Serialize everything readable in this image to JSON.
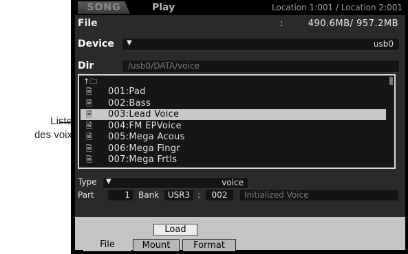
{
  "callout": {
    "line1": "Liste",
    "line2": "des voix"
  },
  "header": {
    "mode_tab": "SONG",
    "sub_tab": "Play",
    "location": "Location 1:001 / Location 2:001"
  },
  "file": {
    "label": "File",
    "colon": ":",
    "size": "490.6MB/  957.2MB"
  },
  "device": {
    "label": "Device",
    "value": "usb0",
    "arrow": "▼"
  },
  "dir": {
    "label": "Dir",
    "value": "/usb0/DATA/voice"
  },
  "file_list": {
    "up_entry": "↑🗀",
    "items": [
      {
        "name": "001:Pad"
      },
      {
        "name": "002:Bass"
      },
      {
        "name": "003:Lead Voice",
        "selected": true
      },
      {
        "name": "004:FM EPVoice"
      },
      {
        "name": "005:Mega Acous"
      },
      {
        "name": "006:Mega Fingr"
      },
      {
        "name": "007:Mega Frtls"
      }
    ]
  },
  "type": {
    "label": "Type",
    "arrow": "▼",
    "value": "voice"
  },
  "part": {
    "label": "Part",
    "number": "1",
    "bank_label": "Bank",
    "bank_value": "USR3",
    "colon": ":",
    "voice_number": "002",
    "voice_name": "Initialized Voice"
  },
  "buttons": {
    "load": "Load"
  },
  "tabs": [
    {
      "label": "File",
      "active": true
    },
    {
      "label": "Mount"
    },
    {
      "label": "Format"
    }
  ]
}
